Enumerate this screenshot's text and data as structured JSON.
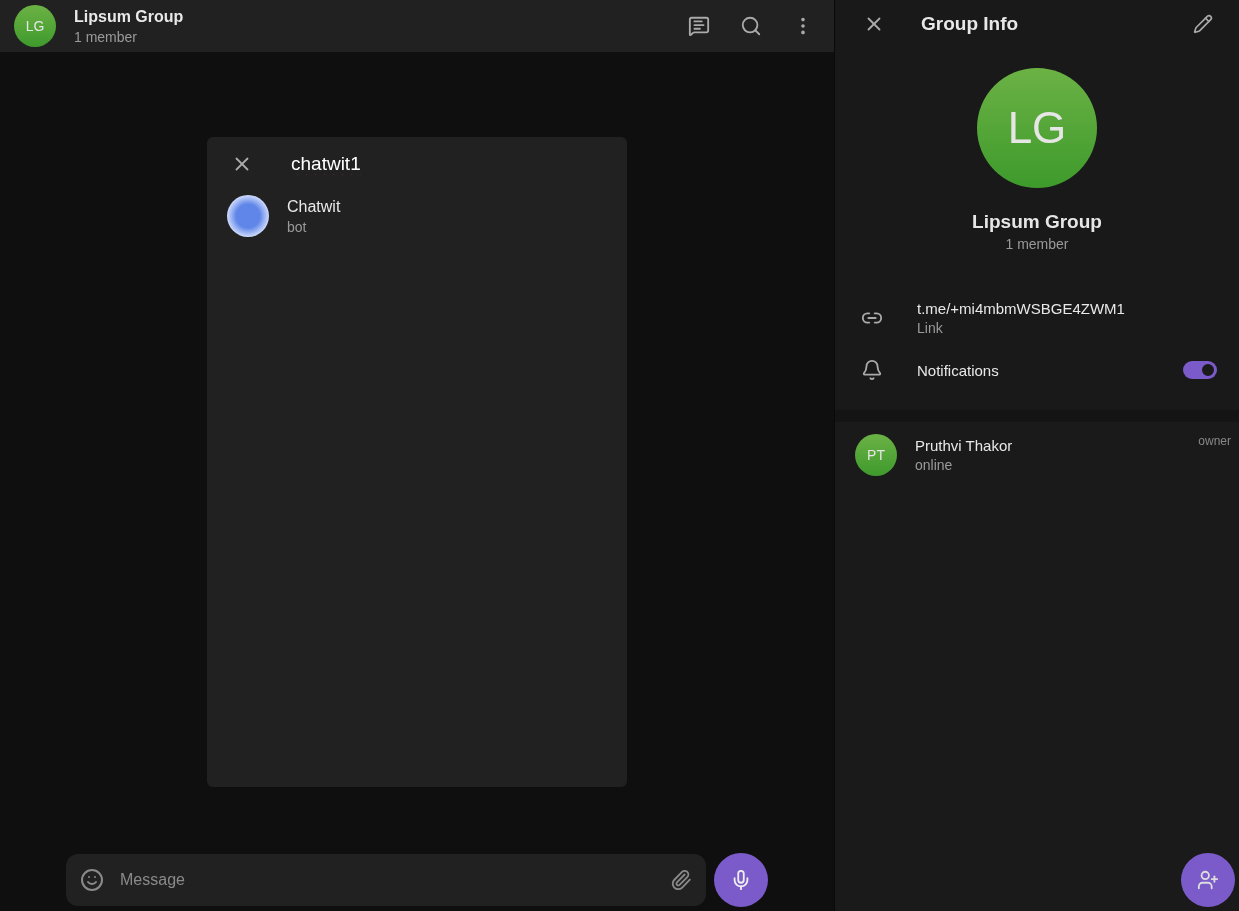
{
  "chat": {
    "avatar": "LG",
    "title": "Lipsum Group",
    "subtitle": "1 member"
  },
  "search_dialog": {
    "query": "chatwit1",
    "results": [
      {
        "name": "Chatwit",
        "subtitle": "bot"
      }
    ]
  },
  "composer": {
    "placeholder": "Message"
  },
  "info": {
    "title": "Group Info",
    "avatar": "LG",
    "name": "Lipsum Group",
    "subtitle": "1 member",
    "link": {
      "value": "t.me/+mi4mbmWSBGE4ZWM1",
      "label": "Link"
    },
    "notifications": {
      "label": "Notifications",
      "on": true
    },
    "members": [
      {
        "avatar": "PT",
        "name": "Pruthvi Thakor",
        "status": "online",
        "role": "owner"
      }
    ]
  }
}
